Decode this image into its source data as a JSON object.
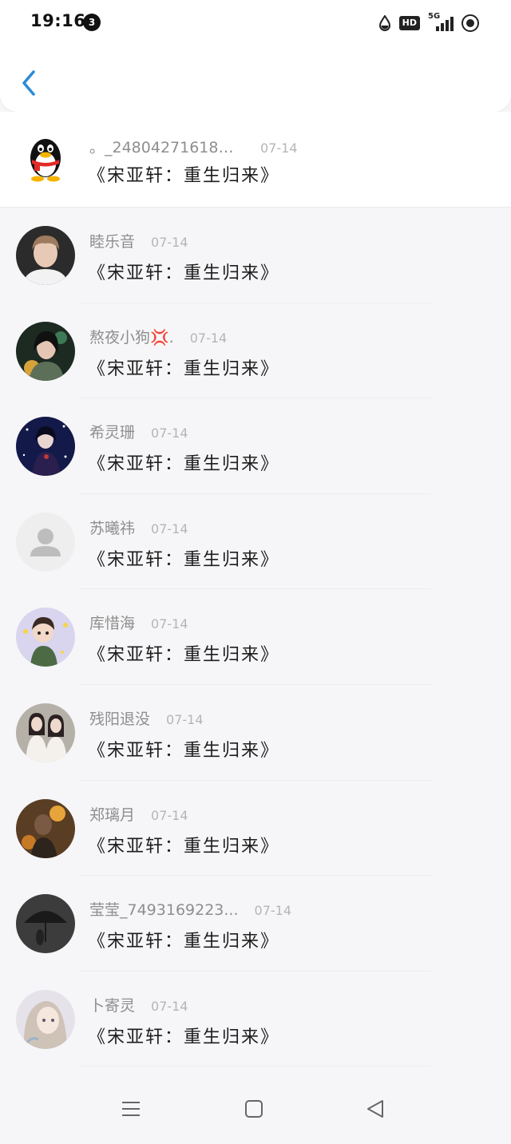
{
  "status_bar": {
    "time": "19:16",
    "notification_count": "3",
    "hd_label": "HD",
    "network_label": "5G"
  },
  "messages": [
    {
      "name": "。_248042716181...",
      "date": "07-14",
      "text": "《宋亚轩：重生归来》"
    },
    {
      "name": "睦乐音",
      "date": "07-14",
      "text": "《宋亚轩：重生归来》"
    },
    {
      "name": "熬夜小狗💢.",
      "date": "07-14",
      "text": "《宋亚轩：重生归来》"
    },
    {
      "name": "希灵珊",
      "date": "07-14",
      "text": "《宋亚轩：重生归来》"
    },
    {
      "name": "苏曦祎",
      "date": "07-14",
      "text": "《宋亚轩：重生归来》"
    },
    {
      "name": "库惜海",
      "date": "07-14",
      "text": "《宋亚轩：重生归来》"
    },
    {
      "name": "残阳退没",
      "date": "07-14",
      "text": "《宋亚轩：重生归来》"
    },
    {
      "name": "郑璃月",
      "date": "07-14",
      "text": "《宋亚轩：重生归来》"
    },
    {
      "name": "莹莹_7493169223...",
      "date": "07-14",
      "text": "《宋亚轩：重生归来》"
    },
    {
      "name": "卜寄灵",
      "date": "07-14",
      "text": "《宋亚轩：重生归来》"
    }
  ],
  "colors": {
    "accent": "#2a8bd8",
    "background": "#f6f6f8",
    "name_text": "#8e8e8e",
    "date_text": "#b5b5b5"
  }
}
